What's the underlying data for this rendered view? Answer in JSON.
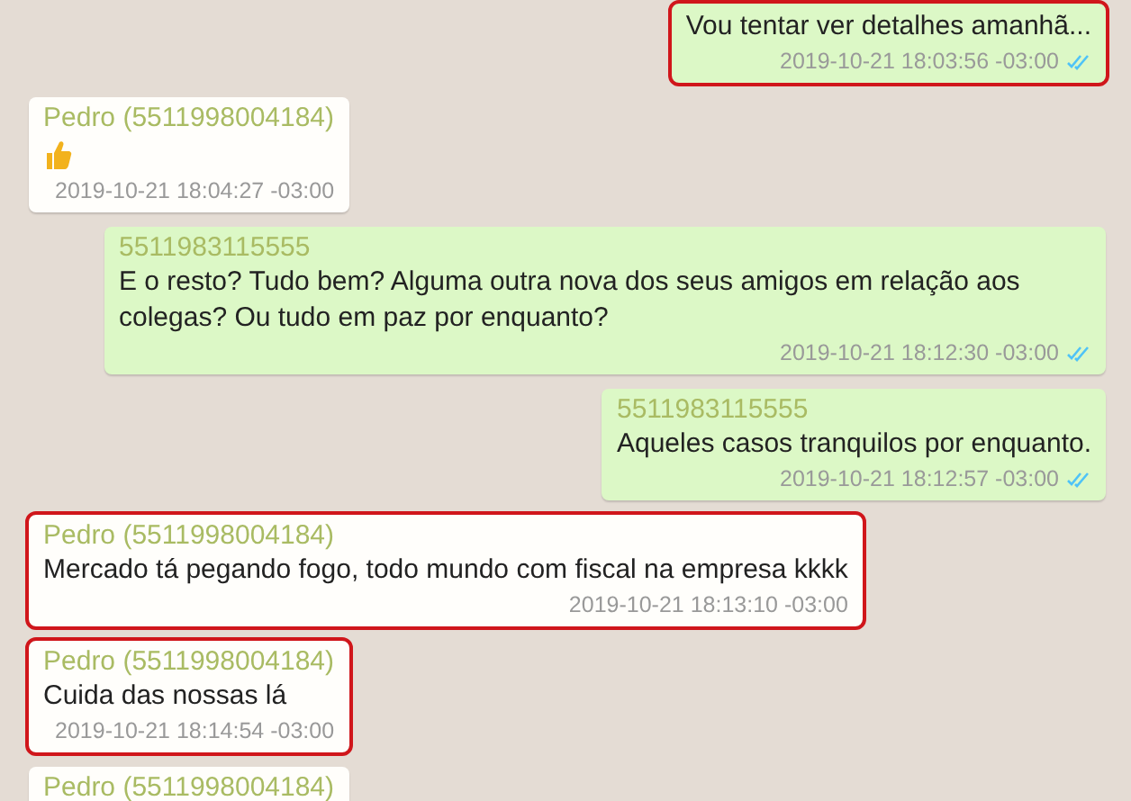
{
  "messages": [
    {
      "outgoing": true,
      "kind": "text",
      "text": "Vou tentar ver detalhes amanhã...",
      "time": "2019-10-21 18:03:56 -03:00",
      "read": true,
      "highlighted": true
    },
    {
      "outgoing": false,
      "kind": "thumbs-up",
      "sender": "Pedro (5511998004184)",
      "time": "2019-10-21 18:04:27 -03:00",
      "highlighted": false
    },
    {
      "outgoing": true,
      "kind": "text",
      "sender": "5511983115555",
      "text": "E o resto? Tudo bem? Alguma outra nova dos seus amigos em relação aos colegas? Ou tudo em paz por enquanto?",
      "time": "2019-10-21 18:12:30 -03:00",
      "read": true,
      "highlighted": false
    },
    {
      "outgoing": true,
      "kind": "text",
      "sender": "5511983115555",
      "text": "Aqueles casos tranquilos por enquanto.",
      "time": "2019-10-21 18:12:57 -03:00",
      "read": true,
      "highlighted": false
    },
    {
      "outgoing": false,
      "kind": "text",
      "sender": "Pedro (5511998004184)",
      "text": "Mercado tá pegando fogo, todo mundo com fiscal na empresa kkkk",
      "time": "2019-10-21 18:13:10 -03:00",
      "highlighted": true
    },
    {
      "outgoing": false,
      "kind": "text",
      "sender": "Pedro (5511998004184)",
      "text": "Cuida das nossas lá",
      "time": "2019-10-21 18:14:54 -03:00",
      "highlighted": true
    },
    {
      "outgoing": false,
      "kind": "header",
      "sender": "Pedro (5511998004184)",
      "highlighted": false
    }
  ]
}
